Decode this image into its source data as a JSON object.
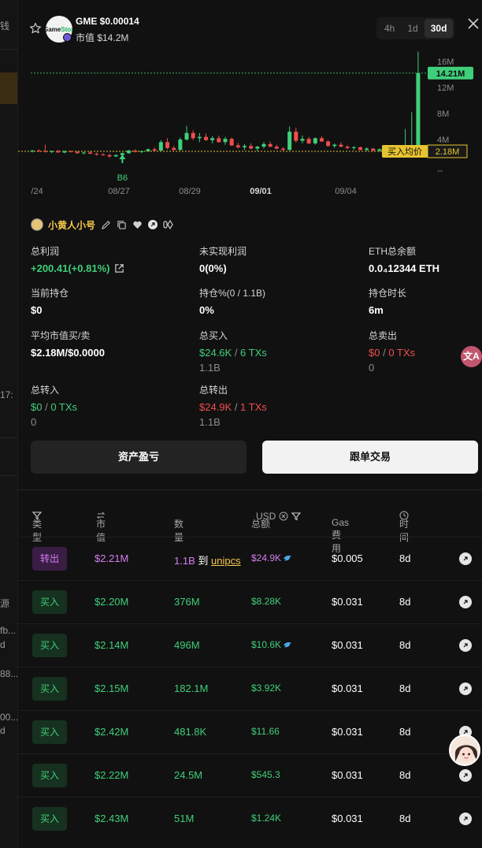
{
  "background": {
    "fragments": [
      "钱",
      "17:",
      "源",
      "fb...",
      "d",
      "88...",
      "00...",
      "d"
    ]
  },
  "header": {
    "token_symbol": "GME",
    "token_price": "$0.00014",
    "token_label": "GME  $0.00014",
    "market_cap": "市值 $14.2M",
    "logo_text_1": "Game",
    "logo_text_2": "Stop",
    "timeframes": [
      {
        "label": "4h",
        "active": false
      },
      {
        "label": "1d",
        "active": false
      },
      {
        "label": "30d",
        "active": true
      }
    ]
  },
  "chart_data": {
    "type": "candlestick",
    "y_ticks": [
      "16M",
      "12M",
      "8M",
      "4M",
      "--"
    ],
    "x_ticks": [
      "/24",
      "08/27",
      "08/29",
      "09/01",
      "09/04"
    ],
    "x_ticks_bold": [
      "09/01"
    ],
    "current_price_label": "14.21M",
    "avg_buy_label": "买入均价",
    "avg_buy_value": "2.18M",
    "marker_label": "B6",
    "colors": {
      "up": "#3fcf7a",
      "down": "#f04d4d",
      "avg": "#e6c430",
      "current": "#3fcf7a"
    },
    "ohlc_millions": [
      [
        2.2,
        2.4,
        2.0,
        2.3
      ],
      [
        2.3,
        2.5,
        2.1,
        2.2
      ],
      [
        2.2,
        3.2,
        2.0,
        2.1
      ],
      [
        2.1,
        2.3,
        1.9,
        2.2
      ],
      [
        2.2,
        2.4,
        2.0,
        2.0
      ],
      [
        2.0,
        2.3,
        1.9,
        2.2
      ],
      [
        2.2,
        2.3,
        2.0,
        2.1
      ],
      [
        2.1,
        2.2,
        1.8,
        1.9
      ],
      [
        1.9,
        2.1,
        1.7,
        2.0
      ],
      [
        2.0,
        2.2,
        1.8,
        1.8
      ],
      [
        1.8,
        2.0,
        1.5,
        1.7
      ],
      [
        1.7,
        1.9,
        1.5,
        1.6
      ],
      [
        1.6,
        1.8,
        1.2,
        1.4
      ],
      [
        1.4,
        1.7,
        1.3,
        1.6
      ],
      [
        1.6,
        2.0,
        1.5,
        1.9
      ],
      [
        1.9,
        2.4,
        1.8,
        2.3
      ],
      [
        2.3,
        2.5,
        2.0,
        2.1
      ],
      [
        2.1,
        2.3,
        1.9,
        2.2
      ],
      [
        2.2,
        2.6,
        2.1,
        2.5
      ],
      [
        2.5,
        2.8,
        2.2,
        2.3
      ],
      [
        2.3,
        3.9,
        2.2,
        3.6
      ],
      [
        3.6,
        4.2,
        2.5,
        2.7
      ],
      [
        2.7,
        3.0,
        2.3,
        2.4
      ],
      [
        2.4,
        4.3,
        2.3,
        4.0
      ],
      [
        4.0,
        6.1,
        3.8,
        5.0
      ],
      [
        5.0,
        5.4,
        3.9,
        4.2
      ],
      [
        4.2,
        5.0,
        3.6,
        4.4
      ],
      [
        4.4,
        4.9,
        3.8,
        3.9
      ],
      [
        3.9,
        4.5,
        3.4,
        4.2
      ],
      [
        4.2,
        4.6,
        3.5,
        3.6
      ],
      [
        3.6,
        4.4,
        3.2,
        4.1
      ],
      [
        4.1,
        4.3,
        3.0,
        3.1
      ],
      [
        3.1,
        3.5,
        2.6,
        2.8
      ],
      [
        2.8,
        3.3,
        2.4,
        3.0
      ],
      [
        3.0,
        3.4,
        2.5,
        2.6
      ],
      [
        2.6,
        3.0,
        2.2,
        2.9
      ],
      [
        2.9,
        3.6,
        2.6,
        3.3
      ],
      [
        3.3,
        3.7,
        2.8,
        2.9
      ],
      [
        2.9,
        3.2,
        2.5,
        2.6
      ],
      [
        2.6,
        2.8,
        2.3,
        2.4
      ],
      [
        2.4,
        6.0,
        2.3,
        5.2
      ],
      [
        5.2,
        5.8,
        3.5,
        3.8
      ],
      [
        3.8,
        4.6,
        3.4,
        4.1
      ],
      [
        4.1,
        4.4,
        3.3,
        3.4
      ],
      [
        3.4,
        4.3,
        3.2,
        4.2
      ],
      [
        4.2,
        4.5,
        3.6,
        3.7
      ],
      [
        3.7,
        3.9,
        2.9,
        3.0
      ],
      [
        3.0,
        3.4,
        2.7,
        3.2
      ],
      [
        3.2,
        3.6,
        2.8,
        2.9
      ],
      [
        2.9,
        3.1,
        2.5,
        2.7
      ],
      [
        2.7,
        3.0,
        2.4,
        2.8
      ],
      [
        2.8,
        2.9,
        2.3,
        2.4
      ],
      [
        2.4,
        2.8,
        2.2,
        2.6
      ],
      [
        2.6,
        2.7,
        2.2,
        2.3
      ],
      [
        2.3,
        2.6,
        2.1,
        2.5
      ],
      [
        2.5,
        2.6,
        2.1,
        2.2
      ],
      [
        2.2,
        2.4,
        2.0,
        2.1
      ],
      [
        2.1,
        2.5,
        2.0,
        2.4
      ],
      [
        2.4,
        5.6,
        2.3,
        2.6
      ],
      [
        2.6,
        8.2,
        2.5,
        3.0
      ],
      [
        3.0,
        17.5,
        2.9,
        14.2
      ]
    ]
  },
  "wallet": {
    "name": "小黄人小号"
  },
  "stats": {
    "total_profit_label": "总利润",
    "total_profit_value": "+200.41(+0.81%)",
    "unrealized_label": "未实现利润",
    "unrealized_value": "0(0%)",
    "eth_balance_label": "ETH总余额",
    "eth_balance_value": "0.0₄12344 ETH",
    "holding_label": "当前持仓",
    "holding_value": "$0",
    "holding_pct_label": "持仓%(0 / 1.1B)",
    "holding_pct_value": "0%",
    "holding_time_label": "持仓时长",
    "holding_time_value": "6m",
    "avg_mcap_label": "平均市值买/卖",
    "avg_mcap_value": "$2.18M/$0.0000",
    "total_buy_label": "总买入",
    "total_buy_value": "$24.6K",
    "total_buy_sep": " / ",
    "total_buy_txs": "6 TXs",
    "total_buy_sub": "1.1B",
    "total_sell_label": "总卖出",
    "total_sell_value": "$0",
    "total_sell_sep": " / ",
    "total_sell_txs": "0 TXs",
    "total_sell_sub": "0",
    "transfer_in_label": "总转入",
    "transfer_in_value": "$0",
    "transfer_in_sep": " / ",
    "transfer_in_txs": "0 TXs",
    "transfer_in_sub": "0",
    "transfer_out_label": "总转出",
    "transfer_out_value": "$24.9K",
    "transfer_out_sep": " / ",
    "transfer_out_txs": "1 TXs",
    "transfer_out_sub": "1.1B"
  },
  "buttons": {
    "asset_pnl": "资产盈亏",
    "copy_trade": "跟单交易"
  },
  "table": {
    "headers": {
      "type": "类型",
      "mcap": "市值",
      "qty": "数量",
      "total": "总额",
      "usd": "USD",
      "gas": "Gas费用",
      "time": "时间"
    },
    "rows": [
      {
        "type": "转出",
        "kind": "out",
        "mcap": "$2.21M",
        "qty": "1.1B",
        "to_word": "到",
        "to": "unipcs",
        "total": "$24.9K",
        "dolphin": true,
        "gas": "$0.005",
        "time": "8d"
      },
      {
        "type": "买入",
        "kind": "buy",
        "mcap": "$2.20M",
        "qty": "376M",
        "total": "$8.28K",
        "dolphin": false,
        "gas": "$0.031",
        "time": "8d"
      },
      {
        "type": "买入",
        "kind": "buy",
        "mcap": "$2.14M",
        "qty": "496M",
        "total": "$10.6K",
        "dolphin": true,
        "gas": "$0.031",
        "time": "8d"
      },
      {
        "type": "买入",
        "kind": "buy",
        "mcap": "$2.15M",
        "qty": "182.1M",
        "total": "$3.92K",
        "dolphin": false,
        "gas": "$0.031",
        "time": "8d"
      },
      {
        "type": "买入",
        "kind": "buy",
        "mcap": "$2.42M",
        "qty": "481.8K",
        "total": "$11.66",
        "dolphin": false,
        "gas": "$0.031",
        "time": "8d"
      },
      {
        "type": "买入",
        "kind": "buy",
        "mcap": "$2.22M",
        "qty": "24.5M",
        "total": "$545.3",
        "dolphin": false,
        "gas": "$0.031",
        "time": "8d"
      },
      {
        "type": "买入",
        "kind": "buy",
        "mcap": "$2.43M",
        "qty": "51M",
        "total": "$1.24K",
        "dolphin": false,
        "gas": "$0.031",
        "time": "8d"
      }
    ]
  },
  "floating": {
    "translate_icon": "translate-icon",
    "assistant_avatar": "assistant-avatar"
  }
}
